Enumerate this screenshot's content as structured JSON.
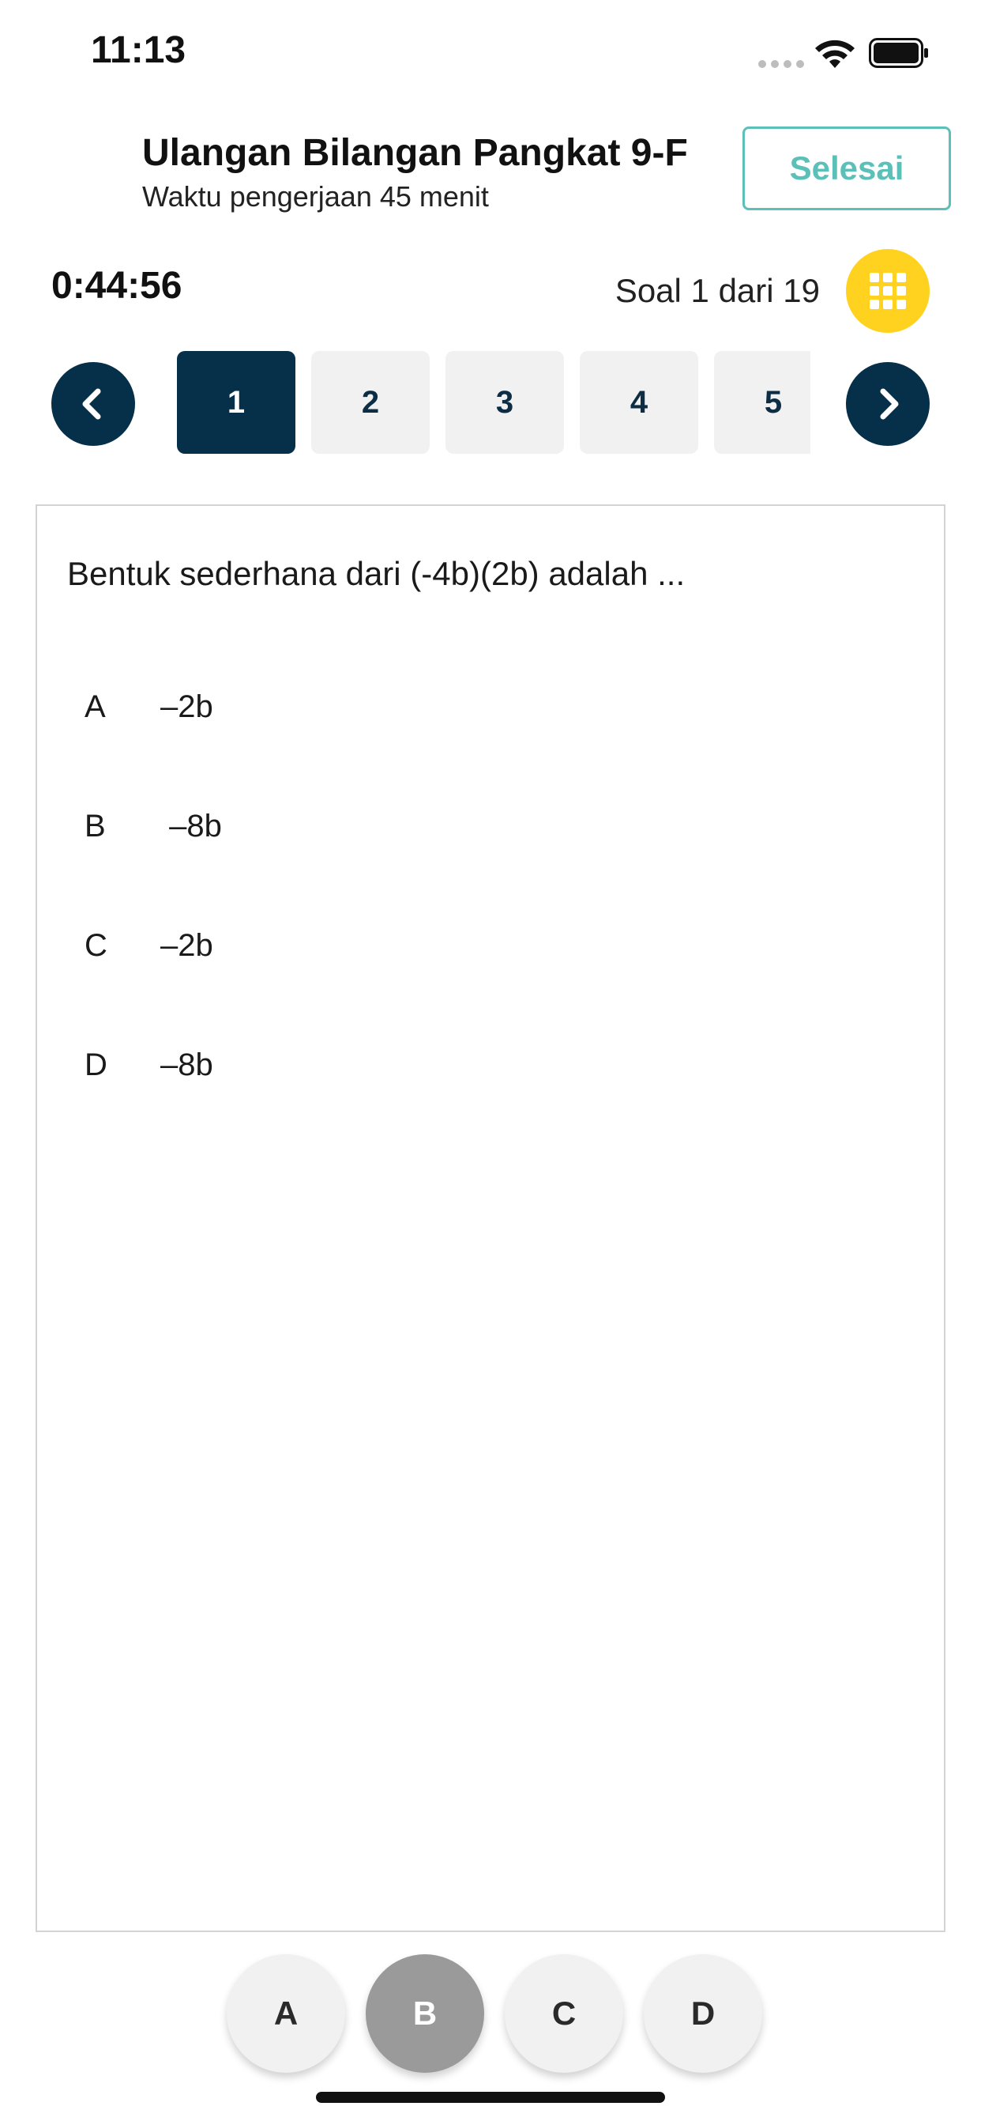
{
  "status_bar": {
    "time": "11:13"
  },
  "header": {
    "title": "Ulangan Bilangan Pangkat 9-F",
    "subtitle": "Waktu pengerjaan 45 menit",
    "finish_label": "Selesai"
  },
  "timer": "0:44:56",
  "progress_label": "Soal 1 dari 19",
  "question_numbers": [
    "1",
    "2",
    "3",
    "4",
    "5"
  ],
  "current_question_index": 0,
  "question": {
    "text": "Bentuk sederhana dari (-4b)(2b) adalah ...",
    "options": [
      {
        "letter": "A",
        "value": "–2b"
      },
      {
        "letter": "B",
        "value": " –8b"
      },
      {
        "letter": "C",
        "value": "–2b"
      },
      {
        "letter": "D",
        "value": "–8b"
      }
    ]
  },
  "answer_buttons": [
    "A",
    "B",
    "C",
    "D"
  ],
  "selected_answer": "B",
  "colors": {
    "navy": "#06304a",
    "accent_teal": "#5bc0b8",
    "grid_yellow": "#ffd21f",
    "selected_gray": "#9a9a9a"
  },
  "icons": {
    "back": "chevron-left-icon",
    "next": "chevron-right-icon",
    "grid": "grid-icon"
  }
}
